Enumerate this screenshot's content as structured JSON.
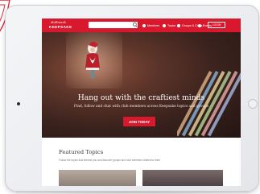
{
  "header": {
    "logo_script": "Hallmark",
    "logo_word": "KEEPSAKE",
    "search_placeholder": "",
    "nav": [
      {
        "label": "Members",
        "icon": "members-icon"
      },
      {
        "label": "Topics",
        "icon": "topics-icon"
      },
      {
        "label": "Groups & Clubs",
        "icon": "groups-icon"
      },
      {
        "label": "Events",
        "icon": "events-icon"
      }
    ],
    "login_label": "LOGIN"
  },
  "hero": {
    "title": "Hang out with the craftiest minds",
    "subtitle": "Find, follow and chat with club members across Keepsake topics and groups",
    "cta_label": "JOIN TODAY"
  },
  "featured": {
    "title": "Featured Topics",
    "subtitle": "Follow the topics that interest you and discover groups and club members related to them"
  },
  "colors": {
    "brand_red": "#d8192d",
    "hero_dark": "#3a221d",
    "tablet_frame": "#eceef1"
  }
}
